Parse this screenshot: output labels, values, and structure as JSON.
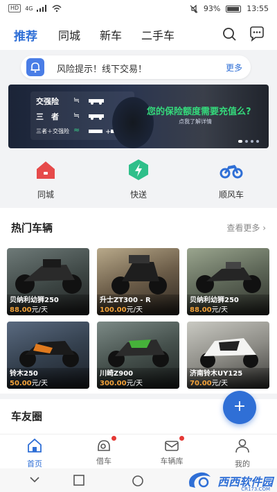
{
  "status": {
    "carrier_tag": "HD",
    "network": "4G",
    "battery_pct": "93%",
    "time": "13:55"
  },
  "topnav": {
    "tabs": [
      "推荐",
      "同城",
      "新车",
      "二手车"
    ],
    "active": 0
  },
  "notice": {
    "text": "风险提示！线下交易！",
    "more": "更多"
  },
  "banner": {
    "rows": [
      "交强险",
      "三　者",
      "三者＋交强险"
    ],
    "headline": "您的保险额度需要充值么?",
    "sub": "点我了解详情"
  },
  "quick": [
    {
      "label": "同城",
      "icon": "home-icon",
      "color": "#e64a4a"
    },
    {
      "label": "快送",
      "icon": "lightning-icon",
      "color": "#2fbf8a"
    },
    {
      "label": "顺风车",
      "icon": "motorcycle-icon",
      "color": "#2f6fd6"
    }
  ],
  "hot": {
    "title": "热门车辆",
    "more": "查看更多",
    "unit": "元/天",
    "cards": [
      {
        "name": "贝纳利幼狮250",
        "price": "88.00"
      },
      {
        "name": "升士ZT300 - R",
        "price": "100.00"
      },
      {
        "name": "贝纳利幼狮250",
        "price": "88.00"
      },
      {
        "name": "铃木250",
        "price": "50.00"
      },
      {
        "name": "川崎Z900",
        "price": "300.00"
      },
      {
        "name": "济南铃木UY125",
        "price": "70.00"
      }
    ]
  },
  "circle": {
    "title": "车友圈"
  },
  "fab": {
    "label": "+"
  },
  "bottomnav": {
    "items": [
      {
        "label": "首页",
        "icon": "home-icon"
      },
      {
        "label": "借车",
        "icon": "helmet-icon"
      },
      {
        "label": "车辆库",
        "icon": "envelope-icon"
      },
      {
        "label": "我的",
        "icon": "user-icon"
      }
    ]
  },
  "watermark": {
    "brand": "西西软件园",
    "domain": "CR173.COM"
  },
  "colors": {
    "accent": "#2f6fd6",
    "price": "#f2a23a",
    "badge": "#e53935"
  }
}
